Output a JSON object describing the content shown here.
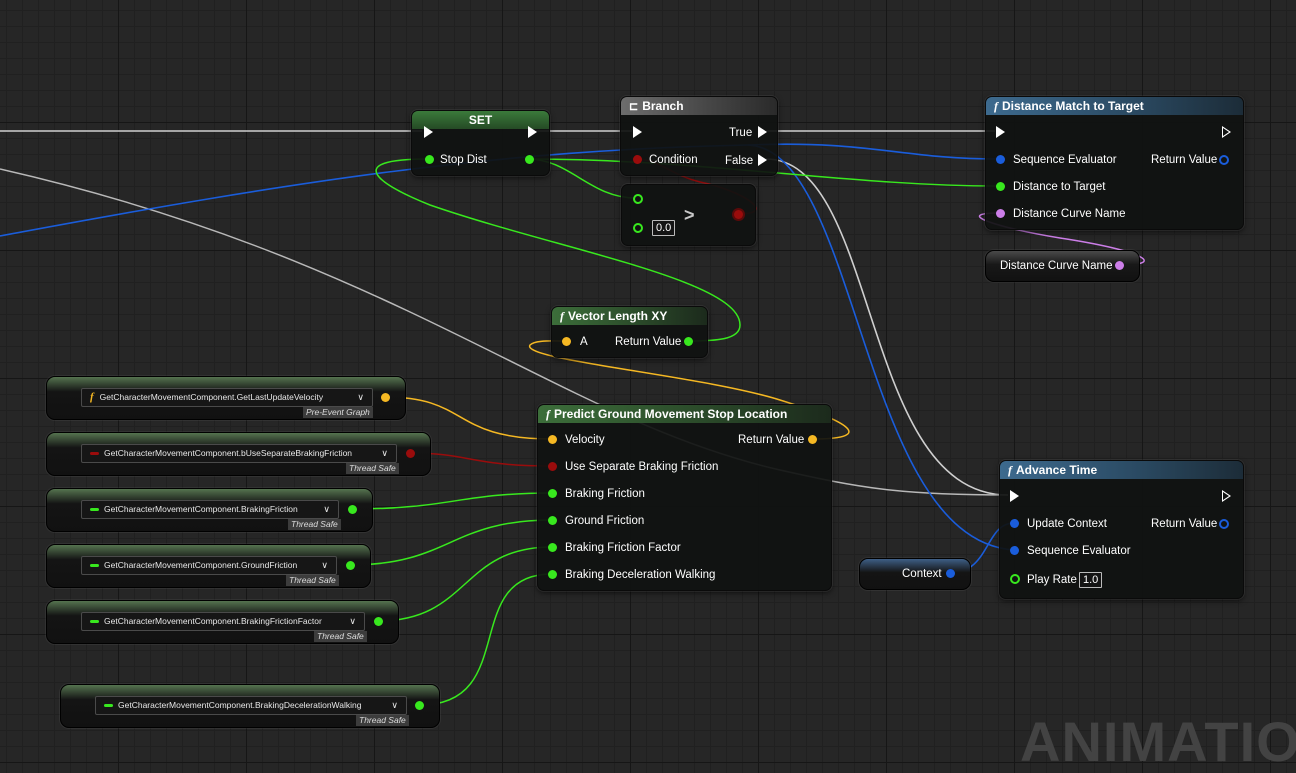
{
  "watermark": "ANIMATION",
  "set_node": {
    "title": "SET",
    "pin_stop_dist": "Stop Dist"
  },
  "branch_node": {
    "title": "Branch",
    "pin_true": "True",
    "pin_false": "False",
    "pin_condition": "Condition"
  },
  "compare_node": {
    "operator": ">",
    "default_value": "0.0"
  },
  "distance_match_node": {
    "title": "Distance Match to Target",
    "pin_sequence_evaluator": "Sequence Evaluator",
    "pin_return_value": "Return Value",
    "pin_distance_to_target": "Distance to Target",
    "pin_distance_curve_name": "Distance Curve Name"
  },
  "distance_curve_var": {
    "label": "Distance Curve Name"
  },
  "vector_length_node": {
    "title": "Vector Length XY",
    "pin_a": "A",
    "pin_return_value": "Return Value"
  },
  "predict_node": {
    "title": "Predict Ground Movement Stop Location",
    "pin_velocity": "Velocity",
    "pin_return_value": "Return Value",
    "pin_use_separate": "Use Separate Braking Friction",
    "pin_braking_friction": "Braking Friction",
    "pin_ground_friction": "Ground Friction",
    "pin_braking_friction_factor": "Braking Friction Factor",
    "pin_braking_decel": "Braking Deceleration Walking"
  },
  "advance_time_node": {
    "title": "Advance Time",
    "pin_update_context": "Update Context",
    "pin_return_value": "Return Value",
    "pin_sequence_evaluator": "Sequence Evaluator",
    "pin_play_rate": "Play Rate",
    "play_rate_value": "1.0"
  },
  "context_var": {
    "label": "Context"
  },
  "getters": [
    {
      "label": "GetCharacterMovementComponent.GetLastUpdateVelocity",
      "tag": "Pre-Event Graph",
      "icon": "function-icon"
    },
    {
      "label": "GetCharacterMovementComponent.bUseSeparateBrakingFriction",
      "tag": "Thread Safe",
      "icon": "bool-dash-icon"
    },
    {
      "label": "GetCharacterMovementComponent.BrakingFriction",
      "tag": "Thread Safe",
      "icon": "float-dash-icon"
    },
    {
      "label": "GetCharacterMovementComponent.GroundFriction",
      "tag": "Thread Safe",
      "icon": "float-dash-icon"
    },
    {
      "label": "GetCharacterMovementComponent.BrakingFrictionFactor",
      "tag": "Thread Safe",
      "icon": "float-dash-icon"
    },
    {
      "label": "GetCharacterMovementComponent.BrakingDecelerationWalking",
      "tag": "Thread Safe",
      "icon": "float-dash-icon"
    }
  ],
  "colors": {
    "exec_wire": "#c8c8c8",
    "float_pin": "#38e81e",
    "vector_pin": "#f5b823",
    "bool_pin": "#9a0c0c",
    "struct_pin": "#1a5ddb",
    "name_pin": "#cc7ee8",
    "function_header": "#3d6a8e",
    "pure_header": "#3c6e3a"
  }
}
